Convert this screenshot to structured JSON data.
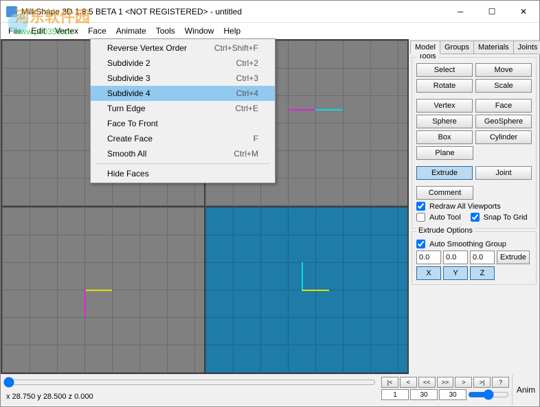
{
  "window": {
    "title": "MilkShape 3D 1.8.5 BETA 1 <NOT REGISTERED> - untitled"
  },
  "watermark": {
    "line1": "河东软件园",
    "line2": "www.pc0359.cn"
  },
  "menubar": [
    "File",
    "Edit",
    "Vertex",
    "Face",
    "Animate",
    "Tools",
    "Window",
    "Help"
  ],
  "dropdown": {
    "items": [
      {
        "label": "Reverse Vertex Order",
        "shortcut": "Ctrl+Shift+F"
      },
      {
        "label": "Subdivide 2",
        "shortcut": "Ctrl+2"
      },
      {
        "label": "Subdivide 3",
        "shortcut": "Ctrl+3"
      },
      {
        "label": "Subdivide 4",
        "shortcut": "Ctrl+4",
        "highlighted": true
      },
      {
        "label": "Turn Edge",
        "shortcut": "Ctrl+E"
      },
      {
        "label": "Face To Front",
        "shortcut": ""
      },
      {
        "label": "Create Face",
        "shortcut": "F"
      },
      {
        "label": "Smooth All",
        "shortcut": "Ctrl+M"
      },
      {
        "sep": true
      },
      {
        "label": "Hide Faces",
        "shortcut": ""
      }
    ]
  },
  "tabs": [
    "Model",
    "Groups",
    "Materials",
    "Joints"
  ],
  "tools": {
    "label": "Tools",
    "buttons": [
      [
        "Select",
        "Move"
      ],
      [
        "Rotate",
        "Scale"
      ],
      [
        "Vertex",
        "Face"
      ],
      [
        "Sphere",
        "GeoSphere"
      ],
      [
        "Box",
        "Cylinder"
      ],
      [
        "Plane",
        ""
      ],
      [
        "Extrude",
        "Joint"
      ],
      [
        "Comment",
        ""
      ]
    ],
    "selected": "Extrude",
    "redraw_label": "Redraw All Viewports",
    "auto_tool_label": "Auto Tool",
    "snap_label": "Snap To Grid"
  },
  "extrude": {
    "label": "Extrude Options",
    "auto_smooth_label": "Auto Smoothing Group",
    "x": "0.0",
    "y": "0.0",
    "z": "0.0",
    "btn": "Extrude",
    "axes": [
      "X",
      "Y",
      "Z"
    ]
  },
  "frames": {
    "ctrls": [
      "|<",
      "<",
      "<<",
      ">>",
      ">",
      ">|",
      "?"
    ],
    "frame1": "1",
    "frame2": "30",
    "frame3": "30",
    "anim": "Anim"
  },
  "status": {
    "coords": "x 28.750 y 28.500 z 0.000"
  }
}
